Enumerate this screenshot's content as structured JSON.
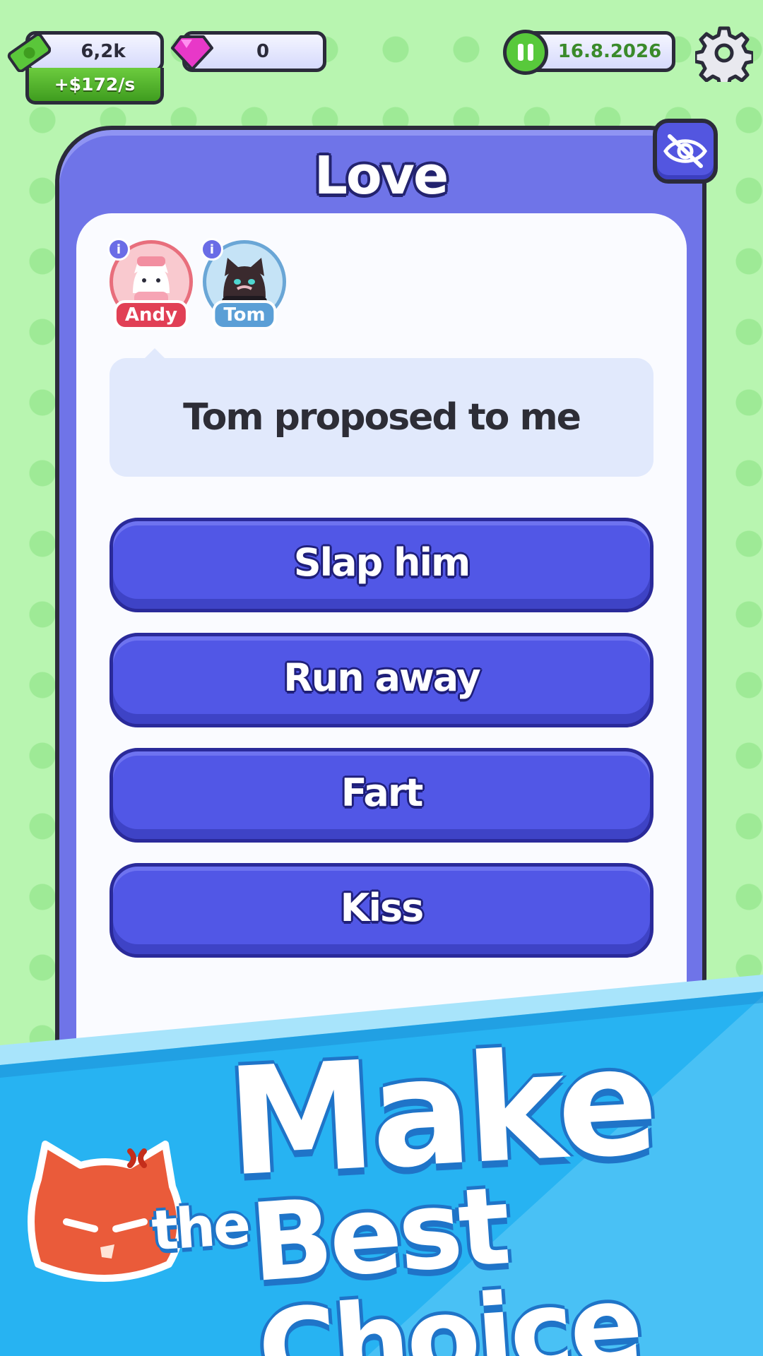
{
  "hud": {
    "cash": "6,2k",
    "cash_rate": "+$172/s",
    "gems": "0",
    "date": "16.8.2026"
  },
  "panel": {
    "title": "Love"
  },
  "characters": [
    {
      "name": "Andy",
      "info": "i"
    },
    {
      "name": "Tom",
      "info": "i"
    }
  ],
  "dialogue": {
    "text": "Tom proposed to me"
  },
  "choices": [
    {
      "label": "Slap him"
    },
    {
      "label": "Run away"
    },
    {
      "label": "Fart"
    },
    {
      "label": "Kiss"
    }
  ],
  "banner": {
    "line1": "Make",
    "line2_small": "the",
    "line2_large": "Best Choice"
  },
  "colors": {
    "background": "#b8f5b0",
    "panel": "#6f74e8",
    "choice_button": "#5157e6",
    "banner": "#27b3f2",
    "cash_green": "#4caf2a",
    "gem_pink": "#e838c8"
  },
  "icons": {
    "cash": "cash-icon",
    "gem": "gem-icon",
    "pause": "pause-icon",
    "settings": "gear-icon",
    "hide": "eye-slash-icon"
  }
}
